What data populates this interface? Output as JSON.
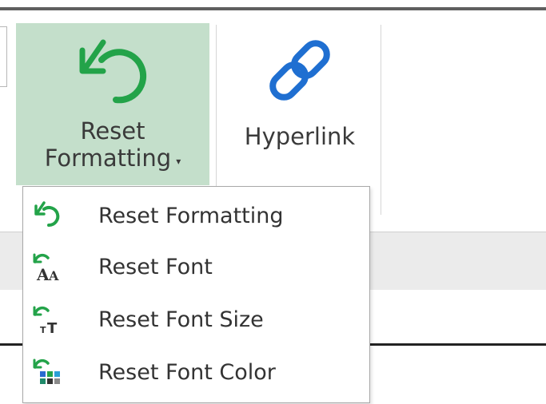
{
  "ribbon": {
    "reset_formatting": {
      "label_line1": "Reset",
      "label_line2": "Formatting",
      "dropdown_caret": "▾",
      "icon": "reset-formatting-icon"
    },
    "hyperlink": {
      "label": "Hyperlink",
      "icon": "hyperlink-icon"
    }
  },
  "menu": {
    "items": [
      {
        "label": "Reset Formatting",
        "icon": "reset-formatting-icon"
      },
      {
        "label": "Reset Font",
        "icon": "reset-font-icon"
      },
      {
        "label": "Reset Font Size",
        "icon": "reset-font-size-icon"
      },
      {
        "label": "Reset Font Color",
        "icon": "reset-font-color-icon"
      }
    ]
  },
  "colors": {
    "accent_green": "#23a349",
    "selected_bg": "#c4dfcb",
    "link_blue": "#1f6fd1"
  }
}
